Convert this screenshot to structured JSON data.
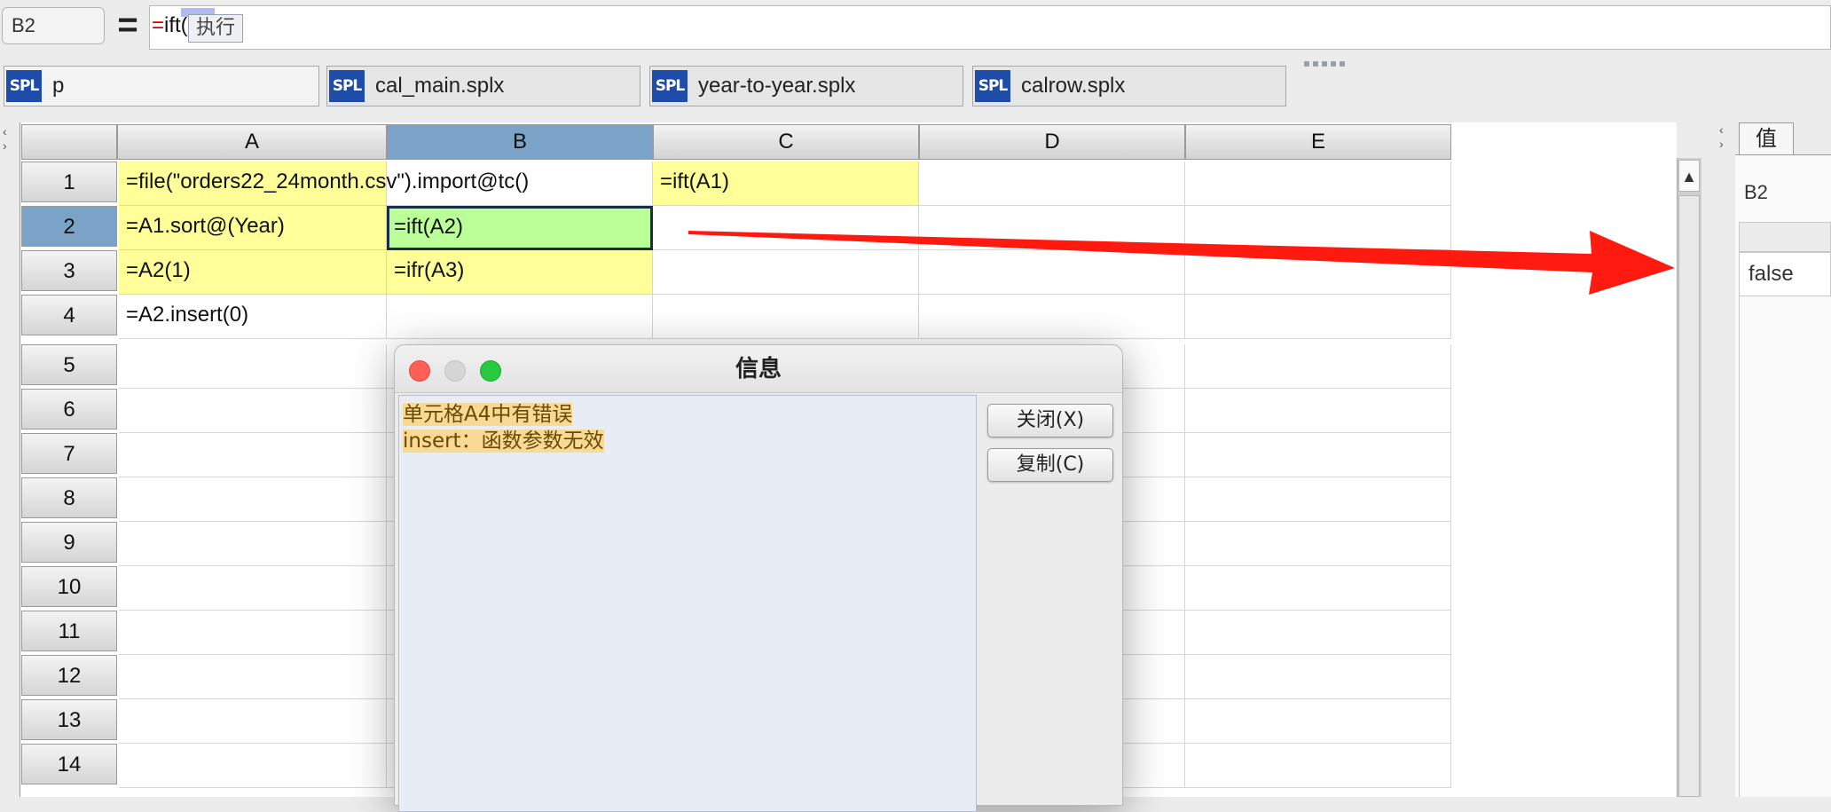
{
  "formula_bar": {
    "cell_ref": "B2",
    "equals_symbol": "=",
    "formula_prefix": "=",
    "formula_text": "ift(",
    "tooltip": "执行"
  },
  "tabs": [
    {
      "badge": "SPL",
      "label": "p"
    },
    {
      "badge": "SPL",
      "label": "cal_main.splx"
    },
    {
      "badge": "SPL",
      "label": "year-to-year.splx"
    },
    {
      "badge": "SPL",
      "label": "calrow.splx"
    }
  ],
  "grid": {
    "columns": [
      "A",
      "B",
      "C",
      "D",
      "E"
    ],
    "selected_column": "B",
    "selected_row": "2",
    "rows": [
      "1",
      "2",
      "3",
      "4",
      "5",
      "6",
      "7",
      "8",
      "9",
      "10",
      "11",
      "12",
      "13",
      "14"
    ],
    "cells": {
      "A1": "=file(\"orders22_24month.csv\").import@tc()",
      "C1": "=ift(A1)",
      "A2": "=A1.sort@(Year)",
      "B2": "=ift(A2)",
      "A3": "=A2(1)",
      "B3": "=ifr(A3)",
      "A4": "=A2.insert(0)"
    },
    "colors": {
      "formula_cell": "#ffff99",
      "active_cell": "#bbff99",
      "header_selected": "#7ba3c8"
    }
  },
  "value_panel": {
    "tab_label": "值",
    "cell_ref": "B2",
    "value": "false"
  },
  "dialog": {
    "title": "信息",
    "message_lines": [
      "单元格A4中有错误",
      "insert：函数参数无效"
    ],
    "close_button": "关闭(X)",
    "copy_button": "复制(C)"
  },
  "annotation": {
    "arrow_color": "#ff1a10"
  }
}
